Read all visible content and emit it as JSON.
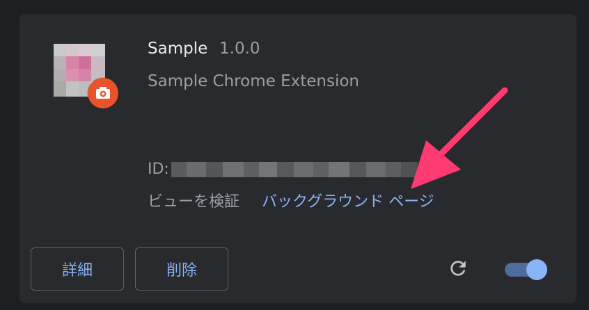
{
  "extension": {
    "name": "Sample",
    "version": "1.0.0",
    "description": "Sample Chrome Extension",
    "id_label": "ID:",
    "inspect_views_label": "ビューを検証",
    "background_page_link": "バックグラウンド ページ"
  },
  "actions": {
    "details_label": "詳細",
    "remove_label": "削除"
  },
  "toggle": {
    "enabled": true
  },
  "icons": {
    "extension": "extension-icon-pixelated",
    "badge": "camera-badge-icon",
    "reload": "reload-icon",
    "arrow": "pink-arrow-annotation"
  },
  "colors": {
    "background": "#1e1f22",
    "card": "#292a2d",
    "primary_text": "#e8eaed",
    "secondary_text": "#9aa0a6",
    "link": "#8ab4f8",
    "badge": "#e8542a",
    "arrow": "#ff3a73"
  }
}
